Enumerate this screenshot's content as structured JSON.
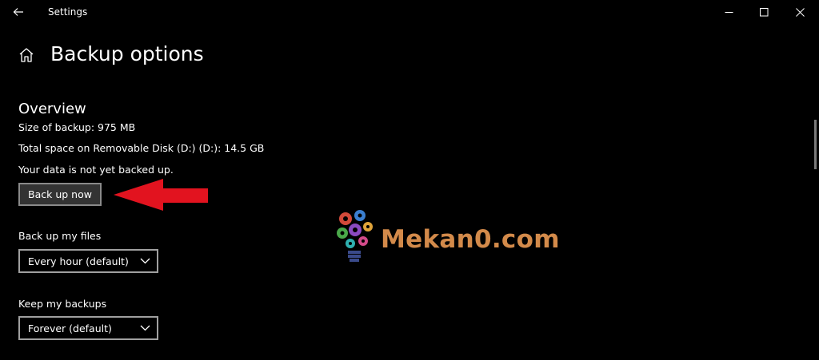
{
  "window": {
    "title": "Settings"
  },
  "header": {
    "title": "Backup options"
  },
  "overview": {
    "heading": "Overview",
    "size_of_backup": "Size of backup: 975 MB",
    "total_space": "Total space on Removable Disk (D:) (D:): 14.5 GB",
    "status": "Your data is not yet backed up.",
    "backup_button": "Back up now"
  },
  "backup_files": {
    "label": "Back up my files",
    "selected": "Every hour (default)"
  },
  "keep_backups": {
    "label": "Keep my backups",
    "selected": "Forever (default)"
  },
  "watermark": {
    "text": "Mekan0.com"
  },
  "colors": {
    "background": "#000000",
    "text": "#ffffff",
    "button_bg": "#333333",
    "annotation_arrow": "#e2131f",
    "watermark_text": "#d38a4a"
  },
  "icons": {
    "back": "back-arrow-icon",
    "home": "home-icon",
    "minimize": "minimize-icon",
    "maximize": "maximize-icon",
    "close": "close-icon",
    "dropdown": "chevron-down-icon"
  }
}
